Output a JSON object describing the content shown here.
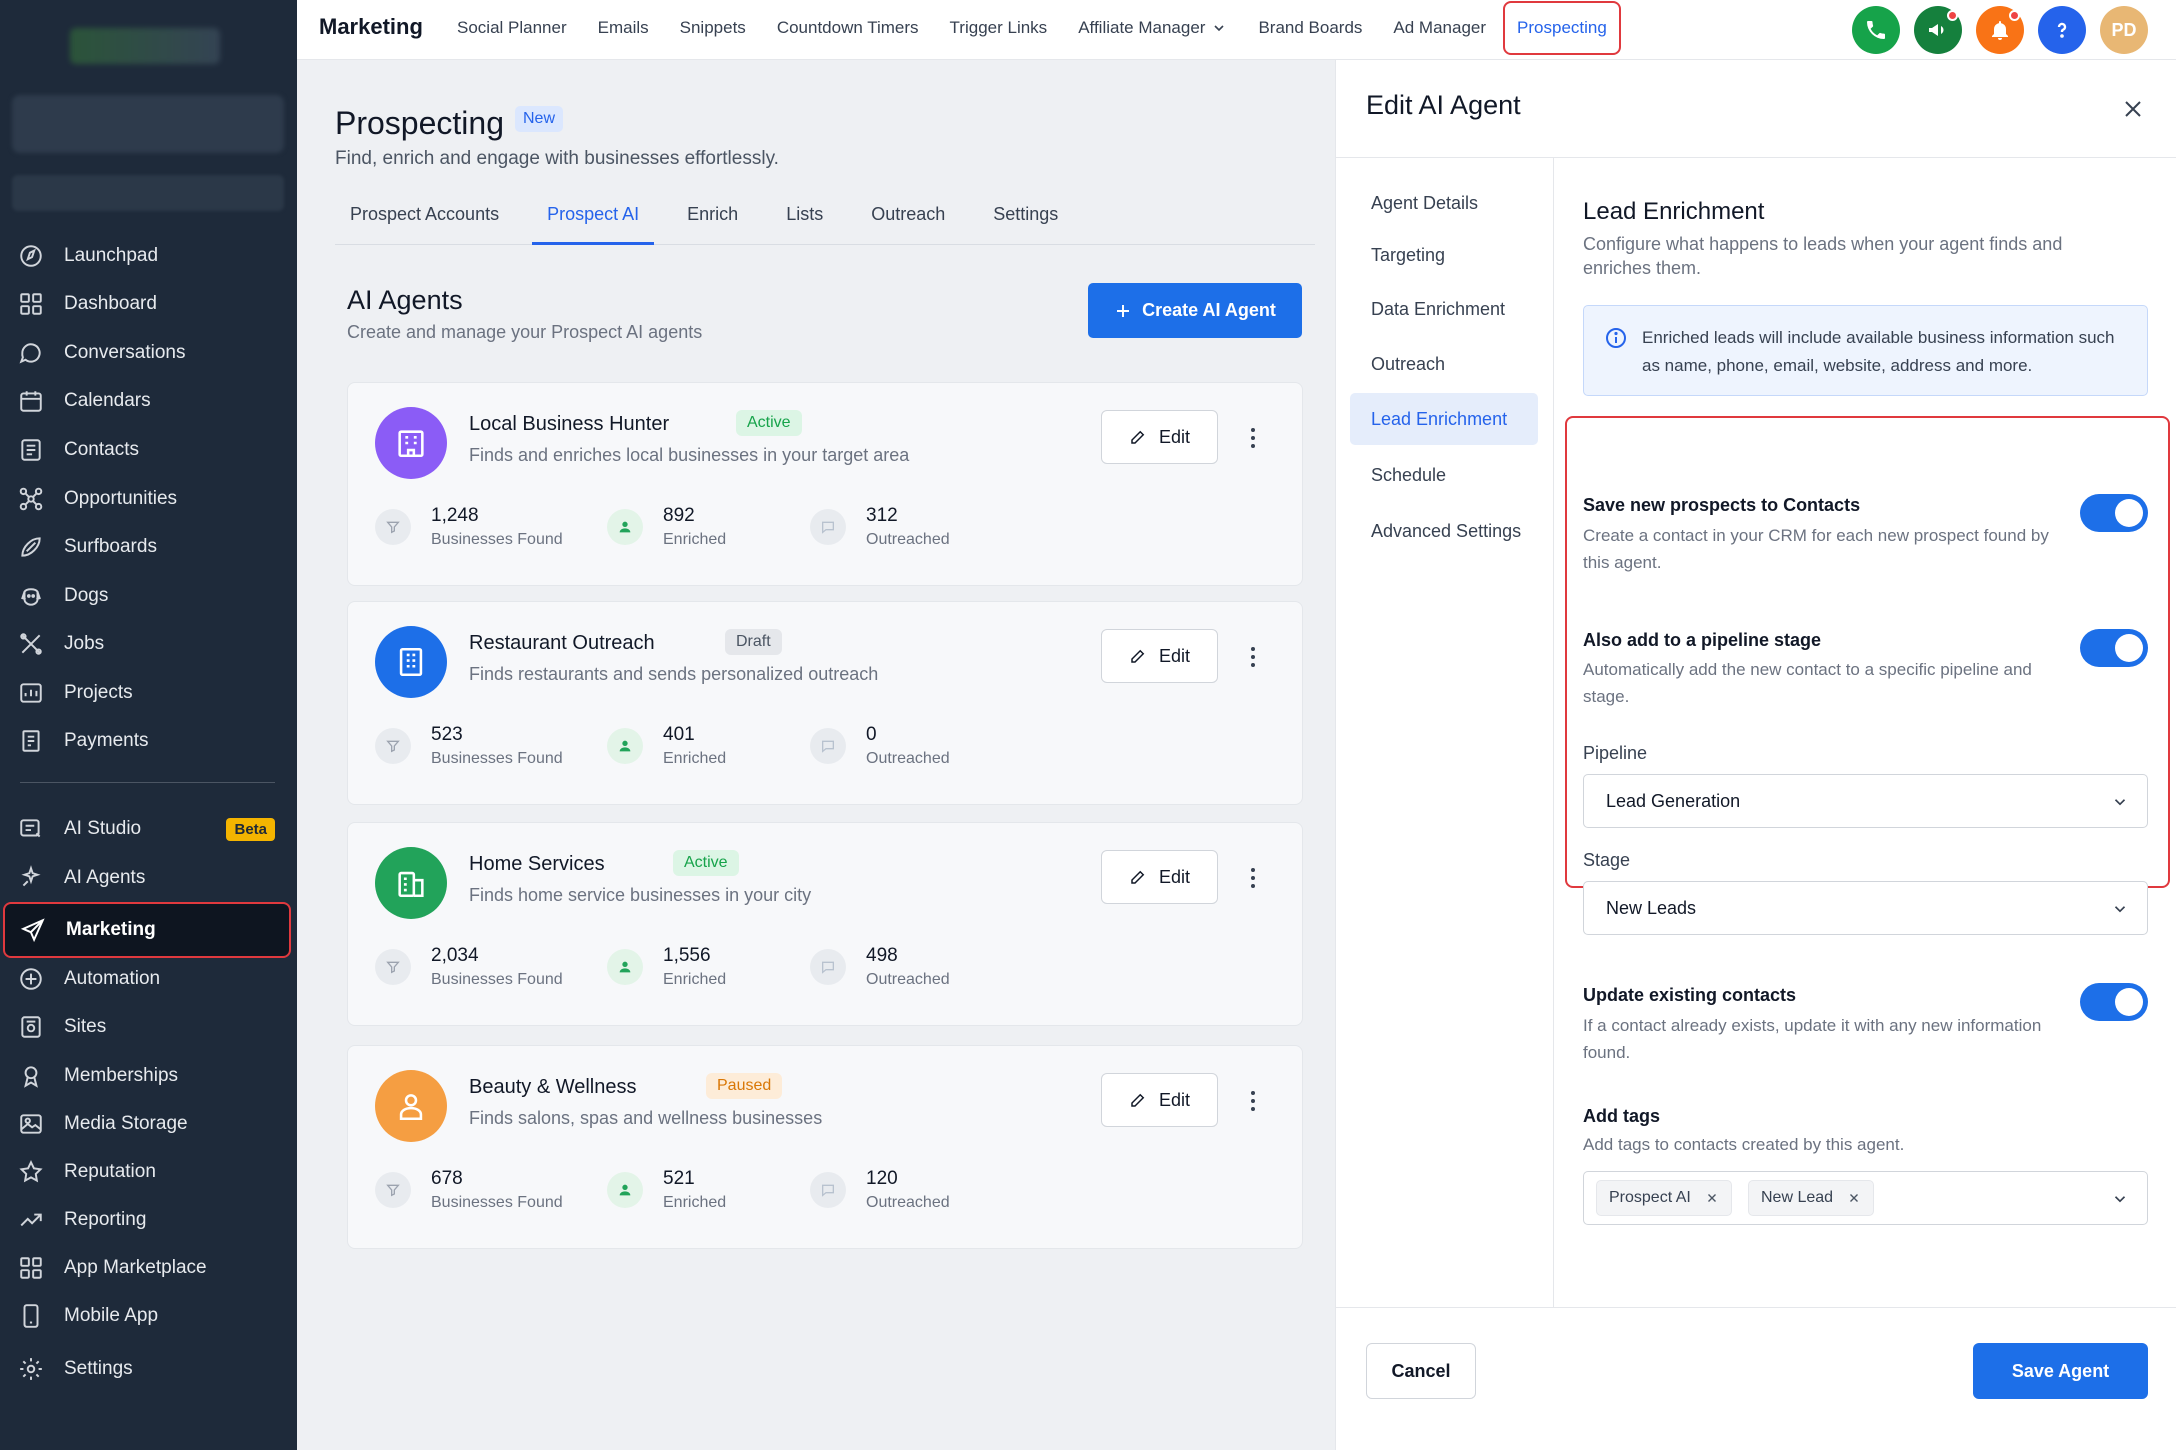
{
  "sidebar": {
    "items": [
      {
        "label": "Launchpad",
        "icon": "launchpad-icon"
      },
      {
        "label": "Dashboard",
        "icon": "dashboard-icon"
      },
      {
        "label": "Conversations",
        "icon": "chat-icon"
      },
      {
        "label": "Calendars",
        "icon": "calendar-icon"
      },
      {
        "label": "Contacts",
        "icon": "contacts-icon"
      },
      {
        "label": "Opportunities",
        "icon": "opportunities-icon"
      },
      {
        "label": "Surfboards",
        "icon": "surfboard-icon"
      },
      {
        "label": "Dogs",
        "icon": "dog-icon"
      },
      {
        "label": "Jobs",
        "icon": "tools-icon"
      },
      {
        "label": "Projects",
        "icon": "projects-icon"
      },
      {
        "label": "Payments",
        "icon": "payments-icon"
      },
      {
        "label": "AI Studio",
        "icon": "ai-studio-icon",
        "badge": "Beta"
      },
      {
        "label": "AI Agents",
        "icon": "ai-agents-icon"
      },
      {
        "label": "Marketing",
        "icon": "send-icon",
        "active": true
      },
      {
        "label": "Automation",
        "icon": "automation-icon"
      },
      {
        "label": "Sites",
        "icon": "sites-icon"
      },
      {
        "label": "Memberships",
        "icon": "memberships-icon"
      },
      {
        "label": "Media Storage",
        "icon": "media-icon"
      },
      {
        "label": "Reputation",
        "icon": "star-icon"
      },
      {
        "label": "Reporting",
        "icon": "trend-icon"
      },
      {
        "label": "App Marketplace",
        "icon": "apps-icon"
      },
      {
        "label": "Mobile App",
        "icon": "mobile-icon"
      },
      {
        "label": "Settings",
        "icon": "gear-icon"
      }
    ]
  },
  "topbar": {
    "title": "Marketing",
    "nav": [
      "Social Planner",
      "Emails",
      "Snippets",
      "Countdown Timers",
      "Trigger Links",
      "Affiliate Manager",
      "Brand Boards",
      "Ad Manager",
      "Prospecting"
    ],
    "active_nav": "Prospecting",
    "avatar_initials": "PD",
    "icon_colors": {
      "phone": "#16a34a",
      "announce": "#15803d",
      "bell": "#f97316",
      "help": "#2563eb"
    }
  },
  "main": {
    "title": "Prospecting",
    "new_badge": "New",
    "subtitle": "Find, enrich and engage with businesses effortlessly.",
    "tabs": [
      "Prospect Accounts",
      "Prospect AI",
      "Enrich",
      "Lists",
      "Outreach",
      "Settings"
    ],
    "active_tab": "Prospect AI",
    "section_title": "AI Agents",
    "section_subtitle": "Create and manage your Prospect AI agents",
    "create_button": "Create AI Agent",
    "edit_label": "Edit",
    "stat_labels": {
      "found": "Businesses Found",
      "enriched": "Enriched",
      "outreached": "Outreached"
    },
    "agents": [
      {
        "name": "Local Business Hunter",
        "status": "Active",
        "description": "Finds and enriches local businesses in your target area",
        "found": "1,248",
        "enriched": "892",
        "outreached": "312",
        "color": "#8b5cf6"
      },
      {
        "name": "Restaurant Outreach",
        "status": "Draft",
        "description": "Finds restaurants and sends personalized outreach",
        "found": "523",
        "enriched": "401",
        "outreached": "0",
        "color": "#1d6fe8"
      },
      {
        "name": "Home Services",
        "status": "Active",
        "description": "Finds home service businesses in your city",
        "found": "2,034",
        "enriched": "1,556",
        "outreached": "498",
        "color": "#22a35a"
      },
      {
        "name": "Beauty & Wellness",
        "status": "Paused",
        "description": "Finds salons, spas and wellness businesses",
        "found": "678",
        "enriched": "521",
        "outreached": "120",
        "color": "#f59e42"
      }
    ]
  },
  "panel": {
    "title": "Edit AI Agent",
    "nav": [
      "Agent Details",
      "Targeting",
      "Data Enrichment",
      "Outreach",
      "Lead Enrichment",
      "Schedule",
      "Advanced Settings"
    ],
    "active_nav": "Lead Enrichment",
    "content": {
      "title": "Lead Enrichment",
      "subtitle": "Configure what happens to leads when your agent finds and enriches them.",
      "info": "Enriched leads will include available business information such as name, phone, email, website, address and more.",
      "save_contacts": {
        "label": "Save new prospects to Contacts",
        "description": "Create a contact in your CRM for each new prospect found by this agent.",
        "enabled": true
      },
      "pipeline_stage": {
        "label": "Also add to a pipeline stage",
        "description": "Automatically add the new contact to a specific pipeline and stage.",
        "enabled": true
      },
      "pipeline": {
        "label": "Pipeline",
        "value": "Lead Generation"
      },
      "stage": {
        "label": "Stage",
        "value": "New Leads"
      },
      "update_contacts": {
        "label": "Update existing contacts",
        "description": "If a contact already exists, update it with any new information found.",
        "enabled": true
      },
      "tags": {
        "label": "Add tags",
        "description": "Add tags to contacts created by this agent.",
        "values": [
          "Prospect AI",
          "New Lead"
        ]
      }
    },
    "cancel": "Cancel",
    "save": "Save Agent"
  }
}
